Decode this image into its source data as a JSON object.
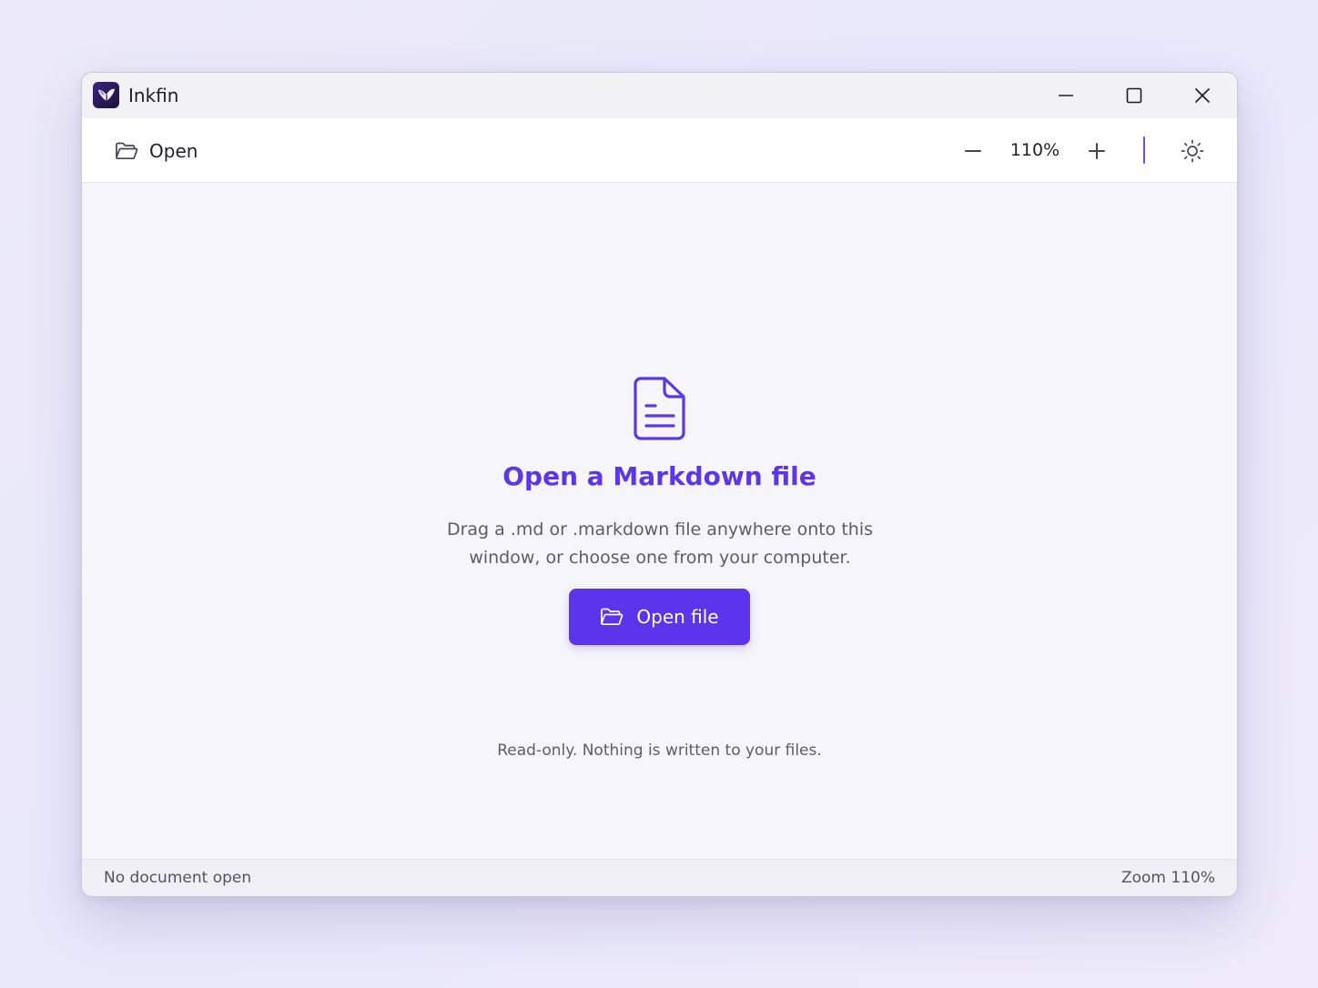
{
  "window": {
    "app_title": "Inkfin",
    "controls": {
      "minimize_icon": "minimize-icon",
      "maximize_icon": "maximize-icon",
      "close_icon": "close-icon"
    }
  },
  "toolbar": {
    "open_label": "Open",
    "open_icon": "folder-open-icon",
    "zoom_value": "110%",
    "zoom_out_icon": "minus-icon",
    "zoom_in_icon": "plus-icon",
    "theme_icon": "sun-icon"
  },
  "empty_state": {
    "icon": "document-icon",
    "heading": "Open a Markdown file",
    "description": "Drag a .md or .markdown file anywhere onto this window, or choose one from your computer.",
    "button_label": "Open file",
    "button_icon": "folder-open-icon",
    "note": "Read-only. Nothing is written to your files."
  },
  "statusbar": {
    "left": "No document open",
    "right": "Zoom 110%"
  },
  "colors": {
    "accent": "#5a35ec",
    "heading": "#5b37e6",
    "content_bg": "#f6f5fb",
    "titlebar_bg": "#f2f2f5"
  }
}
